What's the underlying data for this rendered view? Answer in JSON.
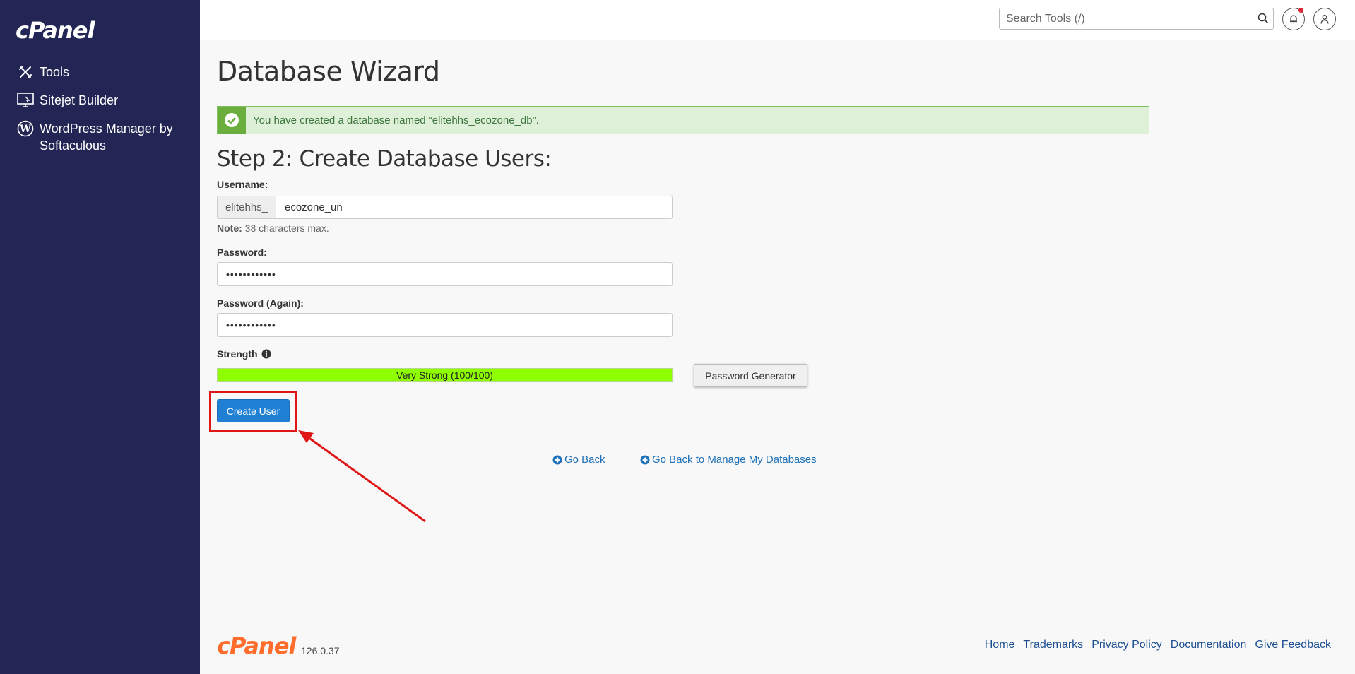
{
  "sidebar": {
    "logo": "cPanel",
    "items": [
      {
        "label": "Tools",
        "icon": "tools-icon"
      },
      {
        "label": "Sitejet Builder",
        "icon": "sitejet-icon"
      },
      {
        "label": "WordPress Manager by Softaculous",
        "icon": "wordpress-icon"
      }
    ]
  },
  "header": {
    "search_placeholder": "Search Tools (/)",
    "notification_dot_color": "#e0283c"
  },
  "main": {
    "title": "Database Wizard",
    "alert_message": "You have created a database named “elitehhs_ecozone_db”.",
    "step_title": "Step 2: Create Database Users:",
    "username_label": "Username:",
    "username_prefix": "elitehhs_",
    "username_value": "ecozone_un",
    "note_label": "Note:",
    "note_text": " 38 characters max.",
    "password_label": "Password:",
    "password_value": "••••••••••••",
    "password_again_label": "Password (Again):",
    "password_again_value": "••••••••••••",
    "strength_label": "Strength",
    "strength_text": "Very Strong (100/100)",
    "strength_percent": 100,
    "password_generator_label": "Password Generator",
    "create_user_label": "Create User",
    "go_back_label": "Go Back",
    "go_back_manage_label": "Go Back to Manage My Databases"
  },
  "footer": {
    "logo": "cPanel",
    "version": "126.0.37",
    "links": [
      "Home",
      "Trademarks",
      "Privacy Policy",
      "Documentation",
      "Give Feedback"
    ]
  },
  "colors": {
    "sidebar_bg": "#232654",
    "accent": "#1f80d4",
    "success_bg": "#dff0d8",
    "strength_bar": "#8fff00",
    "highlight": "#e01616",
    "cpanel_orange": "#ff6c2c"
  }
}
